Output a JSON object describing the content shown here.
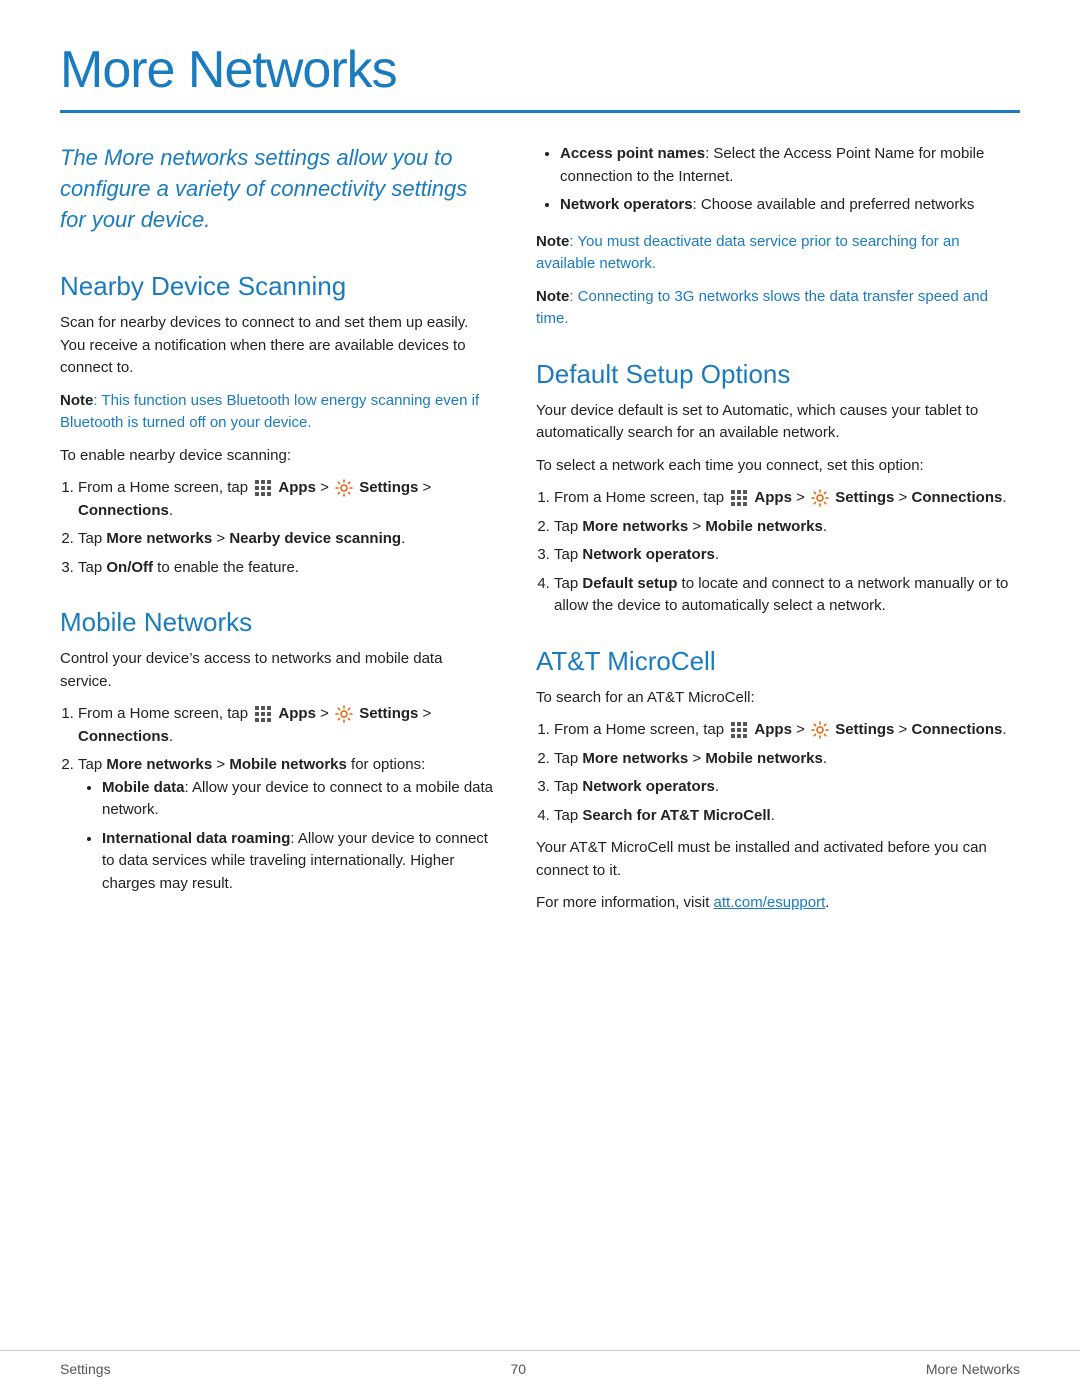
{
  "page": {
    "title": "More Networks",
    "title_rule": true,
    "intro": "The More networks settings allow you to configure a variety of connectivity settings for your device."
  },
  "left_col": {
    "nearby_device": {
      "title": "Nearby Device Scanning",
      "desc": "Scan for nearby devices to connect to and set them up easily. You receive a notification when there are available devices to connect to.",
      "note": "Note: This function uses Bluetooth low energy scanning even if Bluetooth is turned off on your device.",
      "steps_intro": "To enable nearby device scanning:",
      "steps": [
        "From a Home screen, tap  Apps >  Settings > Connections.",
        "Tap More networks > Nearby device scanning.",
        "Tap On/Off to enable the feature."
      ]
    },
    "mobile_networks": {
      "title": "Mobile Networks",
      "desc": "Control your device’s access to networks and mobile data service.",
      "steps_intro": "",
      "steps": [
        "From a Home screen, tap  Apps >  Settings > Connections.",
        "Tap More networks > Mobile networks for options:"
      ],
      "bullets": [
        {
          "term": "Mobile data",
          "desc": "Allow your device to connect to a mobile data network."
        },
        {
          "term": "International data roaming",
          "desc": "Allow your device to connect to data services while traveling internationally. Higher charges may result."
        }
      ]
    }
  },
  "right_col": {
    "right_bullets": [
      {
        "term": "Access point names",
        "desc": "Select the Access Point Name for mobile connection to the Internet."
      },
      {
        "term": "Network operators",
        "desc": "Choose available and preferred networks"
      }
    ],
    "note1": "Note: You must deactivate data service prior to searching for an available network.",
    "note2": "Note: Connecting to 3G networks slows the data transfer speed and time.",
    "default_setup": {
      "title": "Default Setup Options",
      "desc1": "Your device default is set to Automatic, which causes your tablet to automatically search for an available network.",
      "desc2": "To select a network each time you connect, set this option:",
      "steps": [
        "From a Home screen, tap  Apps >  Settings > Connections.",
        "Tap More networks > Mobile networks.",
        "Tap Network operators.",
        "Tap Default setup to locate and connect to a network manually or to allow the device to automatically select a network."
      ]
    },
    "att_microcell": {
      "title": "AT&T MicroCell",
      "desc_intro": "To search for an AT&T MicroCell:",
      "steps": [
        "From a Home screen, tap  Apps >  Settings > Connections.",
        "Tap More networks > Mobile networks.",
        "Tap Network operators.",
        "Tap Search for AT&T MicroCell."
      ],
      "desc_after": "Your AT&T MicroCell must be installed and activated before you can connect to it.",
      "desc_link_pre": "For more information, visit ",
      "link_text": "att.com/esupport",
      "link_href": "att.com/esupport",
      "desc_link_post": "."
    }
  },
  "footer": {
    "left": "Settings",
    "center": "70",
    "right": "More Networks"
  },
  "icons": {
    "apps_label": "Apps",
    "settings_label": "Settings"
  }
}
